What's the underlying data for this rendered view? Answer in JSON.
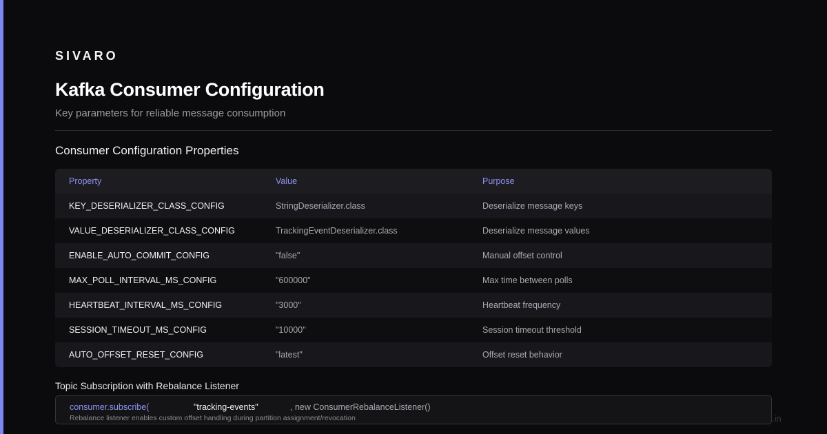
{
  "brand": "SIVARO",
  "title": "Kafka Consumer Configuration",
  "subtitle": "Key parameters for reliable message consumption",
  "section_title": "Consumer Configuration Properties",
  "table": {
    "headers": [
      "Property",
      "Value",
      "Purpose"
    ],
    "rows": [
      [
        "KEY_DESERIALIZER_CLASS_CONFIG",
        "StringDeserializer.class",
        "Deserialize message keys"
      ],
      [
        "VALUE_DESERIALIZER_CLASS_CONFIG",
        "TrackingEventDeserializer.class",
        "Deserialize message values"
      ],
      [
        "ENABLE_AUTO_COMMIT_CONFIG",
        "\"false\"",
        "Manual offset control"
      ],
      [
        "MAX_POLL_INTERVAL_MS_CONFIG",
        "\"600000\"",
        "Max time between polls"
      ],
      [
        "HEARTBEAT_INTERVAL_MS_CONFIG",
        "\"3000\"",
        "Heartbeat frequency"
      ],
      [
        "SESSION_TIMEOUT_MS_CONFIG",
        "\"10000\"",
        "Session timeout threshold"
      ],
      [
        "AUTO_OFFSET_RESET_CONFIG",
        "\"latest\"",
        "Offset reset behavior"
      ]
    ]
  },
  "code": {
    "title": "Topic Subscription with Rebalance Listener",
    "fn": "consumer.subscribe(",
    "arg": "\"tracking-events\"",
    "rest": ", new ConsumerRebalanceListener()",
    "note": "Rebalance listener enables custom offset handling during partition assignment/revocation"
  },
  "watermark": ".in",
  "colors": {
    "accent": "#7b86f2",
    "background": "#0b0b0d"
  }
}
